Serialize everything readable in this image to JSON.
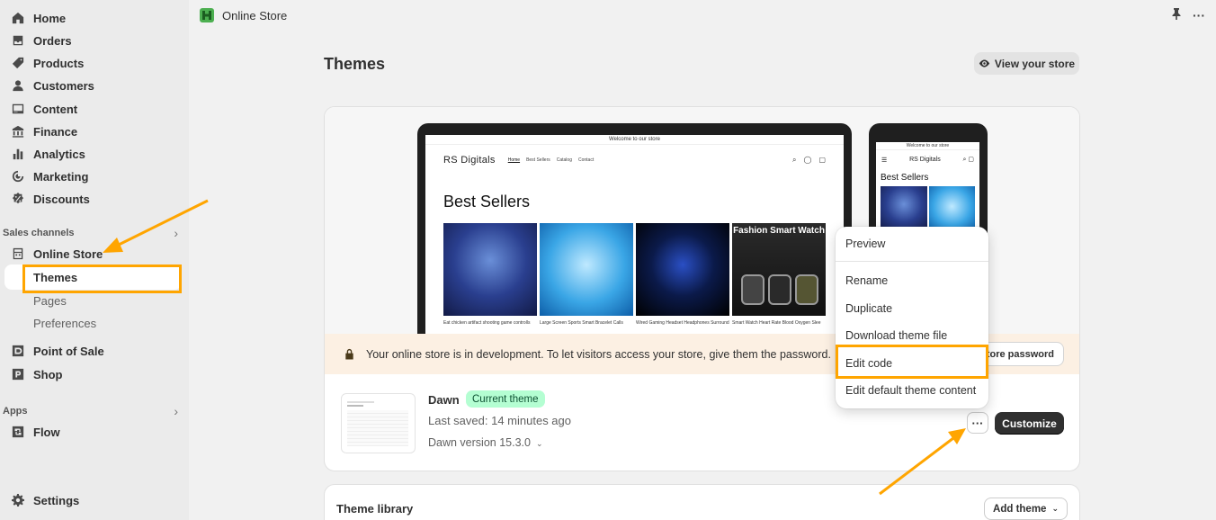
{
  "sidebar": {
    "items": [
      {
        "label": "Home",
        "icon": "home-icon"
      },
      {
        "label": "Orders",
        "icon": "inbox-icon"
      },
      {
        "label": "Products",
        "icon": "tag-icon"
      },
      {
        "label": "Customers",
        "icon": "person-icon"
      },
      {
        "label": "Content",
        "icon": "content-icon"
      },
      {
        "label": "Finance",
        "icon": "bank-icon"
      },
      {
        "label": "Analytics",
        "icon": "chart-bar-icon"
      },
      {
        "label": "Marketing",
        "icon": "target-icon"
      },
      {
        "label": "Discounts",
        "icon": "discount-icon"
      }
    ],
    "sales_channels_label": "Sales channels",
    "online_store": "Online Store",
    "sub_items": {
      "themes": "Themes",
      "pages": "Pages",
      "preferences": "Preferences"
    },
    "point_of_sale": "Point of Sale",
    "shop": "Shop",
    "apps_label": "Apps",
    "flow": "Flow",
    "settings": "Settings"
  },
  "topbar": {
    "title": "Online Store",
    "more": "···"
  },
  "page": {
    "title": "Themes",
    "view_store_label": "View your store"
  },
  "preview": {
    "announcement": "Welcome to our store",
    "brand": "RS Digitals",
    "nav_links": [
      "Home",
      "Best Sellers",
      "Catalog",
      "Contact"
    ],
    "heading": "Best Sellers",
    "products": [
      {
        "name": "Eat chicken artifact shooting game controlls"
      },
      {
        "name": "Large Screen Sports Smart Bracelet Calls"
      },
      {
        "name": "Wired Gaming Headset Headphones Surround"
      },
      {
        "name": "Smart Watch Heart Rate Blood Oxygen Slee",
        "overlay": "Fashion Smart Watch"
      }
    ]
  },
  "banner": {
    "message": "Your online store is in development. To let visitors access your store, give them the password.",
    "button": "Store password"
  },
  "theme": {
    "name": "Dawn",
    "badge": "Current theme",
    "saved": "Last saved: 14 minutes ago",
    "version": "Dawn version 15.3.0",
    "customize": "Customize",
    "dots": "···"
  },
  "menu": {
    "preview": "Preview",
    "rename": "Rename",
    "duplicate": "Duplicate",
    "download": "Download theme file",
    "edit_code": "Edit code",
    "edit_default": "Edit default theme content"
  },
  "library": {
    "title": "Theme library",
    "add_theme": "Add theme"
  },
  "colors": {
    "accent_annotation": "#ffa500",
    "badge_bg": "#b4fed2",
    "primary_btn": "#303030"
  }
}
